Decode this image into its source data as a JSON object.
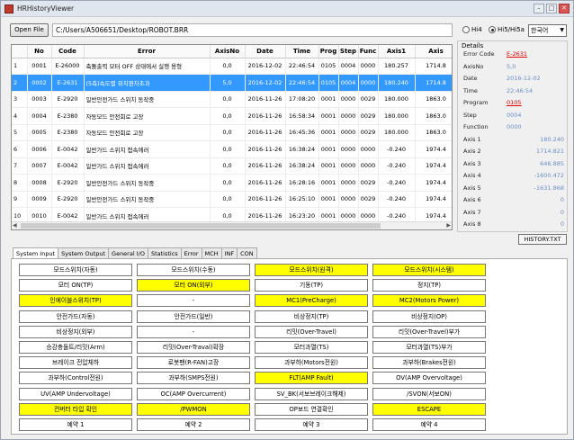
{
  "window": {
    "title": "HRHistoryViewer",
    "controls": [
      "–",
      "□",
      "✕"
    ]
  },
  "toolbar": {
    "open_label": "Open File",
    "path": "C:/Users/A506651/Desktop/ROBOT.BRR",
    "radio_hi4": "Hi4",
    "radio_hi5": "Hi5/Hi5a",
    "lang": "한국어"
  },
  "grid": {
    "headers": [
      "",
      "No",
      "Code",
      "Error",
      "AxisNo",
      "Date",
      "Time",
      "Prog",
      "Step",
      "Func",
      "Axis1",
      "Axis"
    ],
    "rows": [
      [
        "1",
        "0001",
        "E-26000",
        "축돌출력 모터 OFF 상태에서 실행 용형",
        "0,0",
        "2016-12-02",
        "22:46:54",
        "0105",
        "0004",
        "0000",
        "180.257",
        "1714.8"
      ],
      [
        "2",
        "0002",
        "E-2631",
        "(5축)속도별 위치편차초과",
        "5,0",
        "2016-12-02",
        "22:46:54",
        "0105",
        "0004",
        "0000",
        "180.240",
        "1714.8"
      ],
      [
        "3",
        "0003",
        "E-2920",
        "일반안전가드 스위치 동작중",
        "0,0",
        "2016-11-26",
        "17:08:20",
        "0001",
        "0000",
        "0029",
        "180.000",
        "1863.0"
      ],
      [
        "4",
        "0004",
        "E-2380",
        "자동모드 안전회로 고장",
        "0,0",
        "2016-11-26",
        "16:58:34",
        "0001",
        "0000",
        "0029",
        "180.000",
        "1863.0"
      ],
      [
        "5",
        "0005",
        "E-2380",
        "자동모드 안전회로 고장",
        "0,0",
        "2016-11-26",
        "16:45:36",
        "0001",
        "0000",
        "0029",
        "180.000",
        "1863.0"
      ],
      [
        "6",
        "0006",
        "E-0042",
        "일반가드 스위치 접속에러",
        "0,0",
        "2016-11-26",
        "16:38:24",
        "0001",
        "0000",
        "0000",
        "-0.240",
        "1974.4"
      ],
      [
        "7",
        "0007",
        "E-0042",
        "일반가드 스위치 접속에러",
        "0,0",
        "2016-11-26",
        "16:38:24",
        "0001",
        "0000",
        "0000",
        "-0.240",
        "1974.4"
      ],
      [
        "8",
        "0008",
        "E-2920",
        "일반안전가드 스위치 동작중",
        "0,0",
        "2016-11-26",
        "16:28:16",
        "0001",
        "0000",
        "0029",
        "-0.240",
        "1974.4"
      ],
      [
        "9",
        "0009",
        "E-2920",
        "일반안전가드 스위치 동작중",
        "0,0",
        "2016-11-26",
        "16:25:10",
        "0001",
        "0000",
        "0029",
        "-0.240",
        "1974.4"
      ],
      [
        "10",
        "0010",
        "E-0042",
        "일반가드 스위치 접속에러",
        "0,0",
        "2016-11-26",
        "16:23:20",
        "0001",
        "0000",
        "0000",
        "-0.240",
        "1974.4"
      ]
    ],
    "selected_row_index": 1
  },
  "details": {
    "title": "Details",
    "items": [
      {
        "label": "Error Code",
        "value": "E-2631"
      },
      {
        "label": "AxisNo",
        "value": "5,0"
      },
      {
        "label": "Date",
        "value": "2016-12-02"
      },
      {
        "label": "Time",
        "value": "22:46:54"
      },
      {
        "label": "Program",
        "value": "0105"
      },
      {
        "label": "Step",
        "value": "0004"
      },
      {
        "label": "Function",
        "value": "0000"
      },
      {
        "label": "Axis 1",
        "value": "180.240"
      },
      {
        "label": "Axis 2",
        "value": "1714.821"
      },
      {
        "label": "Axis 3",
        "value": "646.885"
      },
      {
        "label": "Axis 4",
        "value": "-1600.472"
      },
      {
        "label": "Axis 5",
        "value": "-1631.868"
      },
      {
        "label": "Axis 6",
        "value": "0"
      },
      {
        "label": "Axis 7",
        "value": "0"
      },
      {
        "label": "Axis 8",
        "value": "0"
      }
    ]
  },
  "history_button": "HISTORY.TXT",
  "tabs": [
    "System Input",
    "System Output",
    "General I/O",
    "Statistics",
    "Error",
    "MCH",
    "INF",
    "CON"
  ],
  "io_grid": [
    [
      {
        "t": "모드스위치(자동)",
        "on": false
      },
      {
        "t": "모드스위치(수동)",
        "on": false
      },
      {
        "t": "모드스위치(원격)",
        "on": true
      },
      {
        "t": "모드스위치(시스템)",
        "on": true
      }
    ],
    [
      {
        "t": "모터 ON(TP)",
        "on": false
      },
      {
        "t": "모터 ON(외부)",
        "on": true
      },
      {
        "t": "기동(TP)",
        "on": false
      },
      {
        "t": "정지(TP)",
        "on": false
      }
    ],
    [
      {
        "t": "인에이블스위치(TP)",
        "on": true
      },
      {
        "t": "-",
        "on": false
      },
      {
        "t": "MC1(PreCharge)",
        "on": true
      },
      {
        "t": "MC2(Motors Power)",
        "on": true
      }
    ],
    [
      {
        "t": "안전가드(자동)",
        "on": false
      },
      {
        "t": "안전가드(일반)",
        "on": false
      },
      {
        "t": "비상정지(TP)",
        "on": false
      },
      {
        "t": "비상정지(OP)",
        "on": false
      }
    ],
    [
      {
        "t": "비상정지(외부)",
        "on": false
      },
      {
        "t": "-",
        "on": false
      },
      {
        "t": "리밋(Over-Travel)",
        "on": false
      },
      {
        "t": "리밋(Over-Travel)부가",
        "on": false
      }
    ],
    [
      {
        "t": "승강충돌트/리밋(Arm)",
        "on": false
      },
      {
        "t": "리밋(Over-Traval)확장",
        "on": false
      },
      {
        "t": "모터과열(TS)",
        "on": false
      },
      {
        "t": "모터과열(TS)부가",
        "on": false
      }
    ],
    [
      {
        "t": "브레이크 전압체하",
        "on": false
      },
      {
        "t": "로봇팬(R-FAN)고장",
        "on": false
      },
      {
        "t": "과부하(Motors전원)",
        "on": false
      },
      {
        "t": "과부하(Brakes전원)",
        "on": false
      }
    ],
    [
      {
        "t": "과부하(Control전원)",
        "on": false
      },
      {
        "t": "과부하(SMPS전원)",
        "on": false
      },
      {
        "t": "FLT(AMP Fault)",
        "on": true
      },
      {
        "t": "OV(AMP Overvoltage)",
        "on": false
      }
    ],
    [
      {
        "t": "UV(AMP Undervoltage)",
        "on": false
      },
      {
        "t": "OC(AMP Overcurrent)",
        "on": false
      },
      {
        "t": "SV_BK(서보브레이크해제)",
        "on": false
      },
      {
        "t": "/SVON(서보ON)",
        "on": false
      }
    ],
    [
      {
        "t": "컨버터 타입 확인",
        "on": true
      },
      {
        "t": "/PWMON",
        "on": true
      },
      {
        "t": "OP보드 연결확인",
        "on": false
      },
      {
        "t": "ESCAPE",
        "on": true
      }
    ],
    [
      {
        "t": "예약 1",
        "on": false
      },
      {
        "t": "예약 2",
        "on": false
      },
      {
        "t": "예약 3",
        "on": false
      },
      {
        "t": "예약 4",
        "on": false
      }
    ]
  ]
}
